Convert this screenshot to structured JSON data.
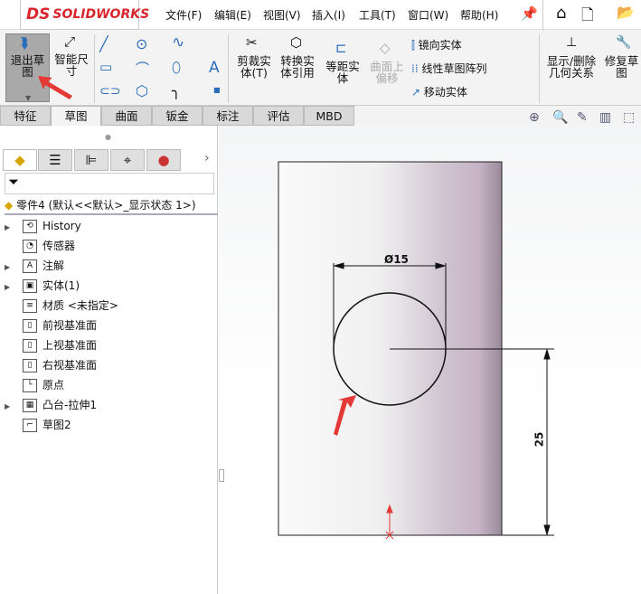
{
  "app": {
    "logo": "SOLIDWORKS",
    "logo_prefix": "DS"
  },
  "menu": [
    "文件(F)",
    "编辑(E)",
    "视图(V)",
    "插入(I)",
    "工具(T)",
    "窗口(W)",
    "帮助(H)"
  ],
  "ribbon": {
    "exit_sketch": "退出草图",
    "smart_dim": "智能尺寸",
    "trim": "剪裁实体(T)",
    "convert": "转换实体引用",
    "offset": "等距实体",
    "surface_offset": "曲面上偏移",
    "mirror": "镜向实体",
    "linear_pattern": "线性草图阵列",
    "move": "移动实体",
    "display_relations": "显示/删除几何关系",
    "repair": "修复草图"
  },
  "tabs": [
    "特征",
    "草图",
    "曲面",
    "钣金",
    "标注",
    "评估",
    "MBD"
  ],
  "active_tab": "草图",
  "tree": {
    "root": "零件4  (默认<<默认>_显示状态 1>)",
    "items": [
      {
        "label": "History",
        "expand": true,
        "icon": "history-folder-icon"
      },
      {
        "label": "传感器",
        "expand": false,
        "icon": "sensor-folder-icon"
      },
      {
        "label": "注解",
        "expand": true,
        "icon": "annotation-folder-icon"
      },
      {
        "label": "实体(1)",
        "expand": true,
        "icon": "solid-bodies-folder-icon"
      },
      {
        "label": "材质 <未指定>",
        "expand": false,
        "icon": "material-icon"
      },
      {
        "label": "前视基准面",
        "expand": false,
        "icon": "plane-icon"
      },
      {
        "label": "上视基准面",
        "expand": false,
        "icon": "plane-icon"
      },
      {
        "label": "右视基准面",
        "expand": false,
        "icon": "plane-icon"
      },
      {
        "label": "原点",
        "expand": false,
        "icon": "origin-icon"
      },
      {
        "label": "凸台-拉伸1",
        "expand": true,
        "icon": "boss-extrude-icon"
      },
      {
        "label": "草图2",
        "expand": false,
        "icon": "sketch-icon"
      }
    ]
  },
  "sketch": {
    "diameter_label": "Ø15",
    "height_label": "25"
  },
  "colors": {
    "accent_red": "#e53935",
    "logo_red": "#d9262c"
  }
}
